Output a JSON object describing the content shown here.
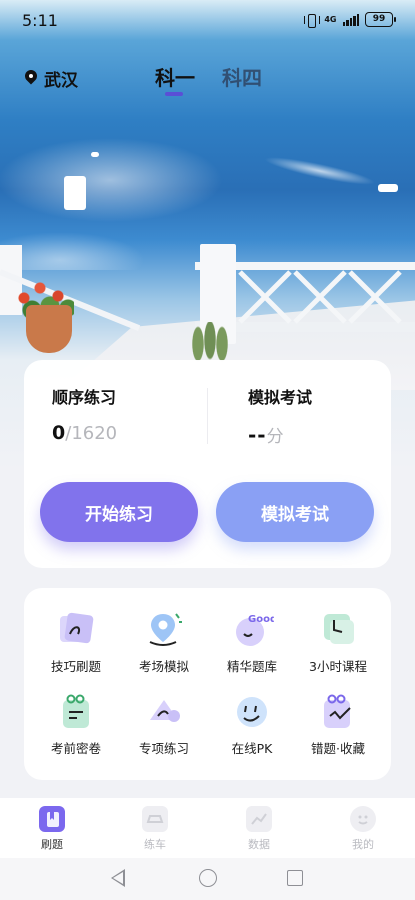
{
  "status_bar": {
    "time": "5:11",
    "network": "4G",
    "battery": "99"
  },
  "header": {
    "location": "武汉",
    "tabs": [
      {
        "label": "科一",
        "active": true
      },
      {
        "label": "科四",
        "active": false
      }
    ]
  },
  "practice": {
    "sequential_title": "顺序练习",
    "progress_current": "0",
    "progress_separator": "/",
    "progress_total": "1620",
    "mock_title": "模拟考试",
    "score_value": "--",
    "score_unit": "分",
    "start_button": "开始练习",
    "exam_button": "模拟考试"
  },
  "features": [
    {
      "label": "技巧刷题",
      "icon": "tips-card-icon"
    },
    {
      "label": "考场模拟",
      "icon": "exam-location-icon"
    },
    {
      "label": "精华题库",
      "icon": "good-badge-icon"
    },
    {
      "label": "3小时课程",
      "icon": "clock-icon"
    },
    {
      "label": "考前密卷",
      "icon": "secret-paper-icon"
    },
    {
      "label": "专项练习",
      "icon": "megaphone-icon"
    },
    {
      "label": "在线PK",
      "icon": "pk-face-icon"
    },
    {
      "label": "错题·收藏",
      "icon": "mistakes-favorites-icon"
    }
  ],
  "bottom_nav": [
    {
      "label": "刷题",
      "active": true
    },
    {
      "label": "练车",
      "active": false
    },
    {
      "label": "数据",
      "active": false
    },
    {
      "label": "我的",
      "active": false
    }
  ],
  "colors": {
    "accent": "#8173ec",
    "accent_secondary": "#8aa0f4",
    "tab_indicator": "#5a4fd6"
  }
}
